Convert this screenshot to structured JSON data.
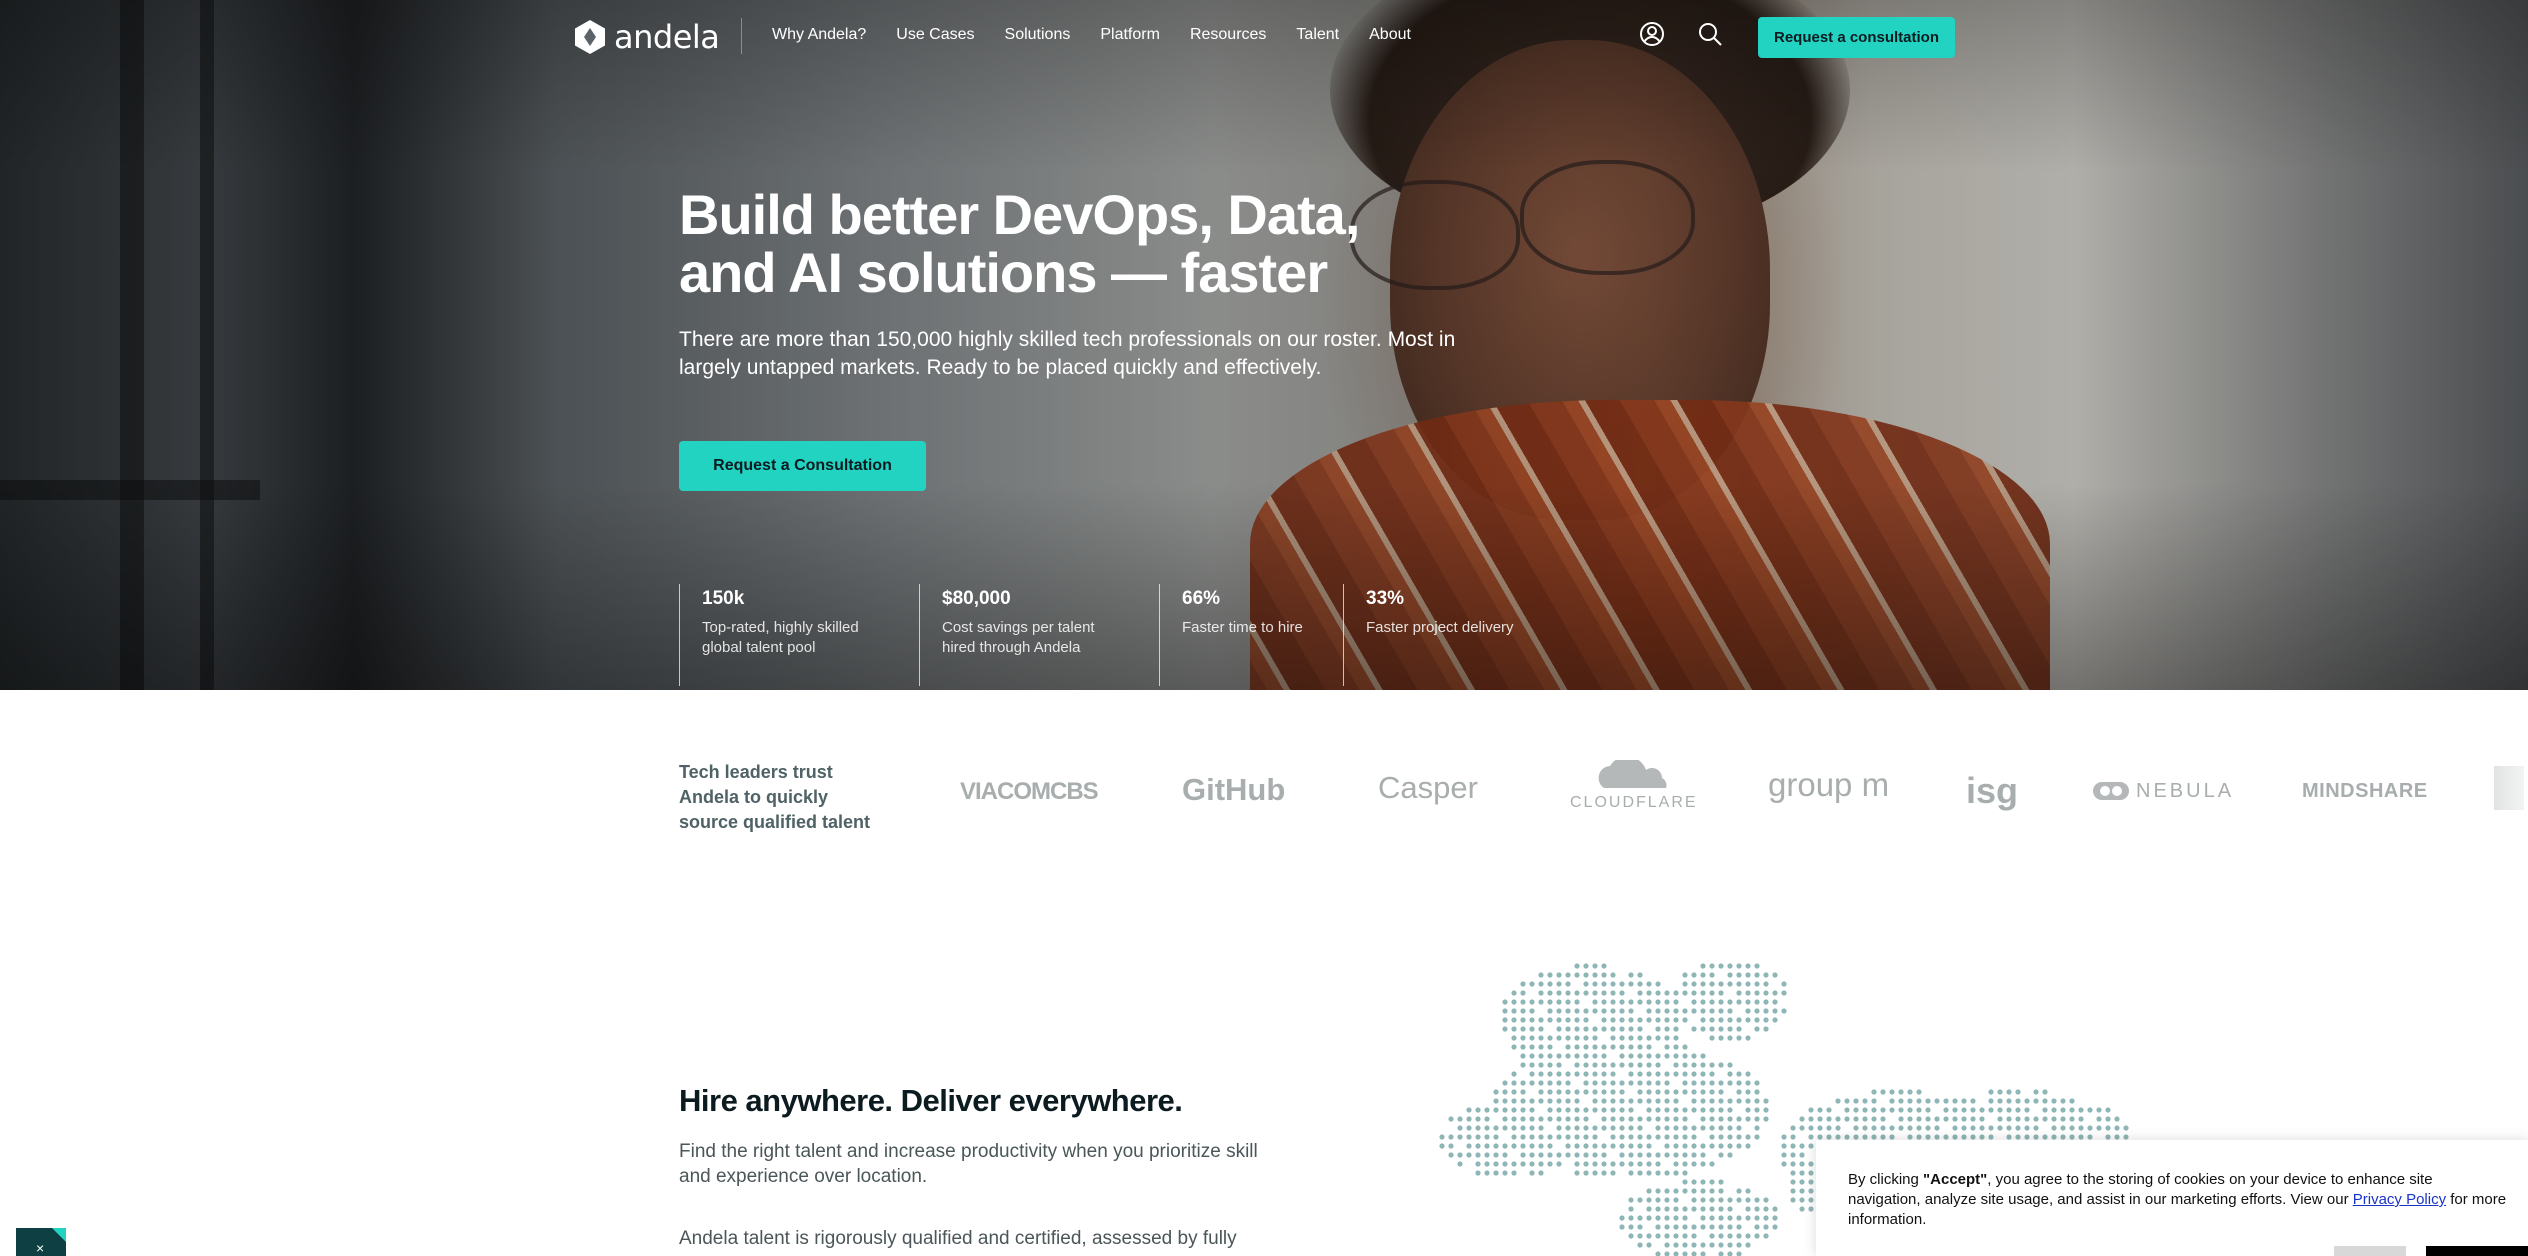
{
  "nav": {
    "logo_text": "andela",
    "links": [
      "Why Andela?",
      "Use Cases",
      "Solutions",
      "Platform",
      "Resources",
      "Talent",
      "About"
    ],
    "account_icon": "user-circle-icon",
    "search_icon": "search-icon",
    "cta_label": "Request a consultation"
  },
  "hero": {
    "title": "Build better DevOps, Data, and AI solutions — faster",
    "subtitle": "There are more than 150,000 highly skilled tech professionals on our roster. Most in largely untapped markets. Ready to be placed quickly and effectively.",
    "cta_label": "Request a Consultation",
    "stats": [
      {
        "value": "150k",
        "label": "Top-rated, highly skilled global talent pool"
      },
      {
        "value": "$80,000",
        "label": "Cost savings per talent hired through Andela"
      },
      {
        "value": "66%",
        "label": "Faster time to hire"
      },
      {
        "value": "33%",
        "label": "Faster project delivery"
      }
    ]
  },
  "trust": {
    "text": "Tech leaders trust Andela to quickly source qualified talent",
    "brands": [
      "VIACOMCBS",
      "GitHub",
      "Casper",
      "CLOUDFLARE",
      "group m",
      "isg",
      "NEBULA",
      "MINDSHARE"
    ]
  },
  "hire": {
    "title": "Hire anywhere. Deliver everywhere.",
    "p1": "Find the right talent and increase productivity when you prioritize skill and experience over location.",
    "p2": "Andela talent is rigorously qualified and certified, assessed by fully"
  },
  "cookie": {
    "prefix": "By clicking ",
    "accept_word": "\"Accept\"",
    "middle": ", you agree to the storing of cookies on your device to enhance site navigation, analyze site usage, and assist in our marketing efforts. View our ",
    "link": "Privacy Policy",
    "suffix": " for more information."
  },
  "colors": {
    "accent": "#23d3c2",
    "text_dark": "#0b1b20",
    "muted": "#4f6266",
    "map_dot": "#8fb6b6"
  }
}
